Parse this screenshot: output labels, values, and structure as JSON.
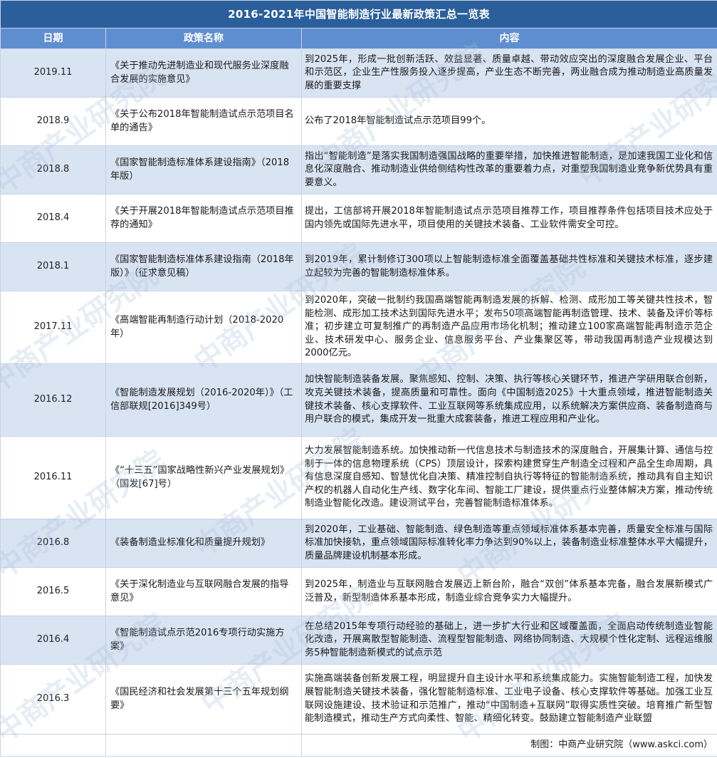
{
  "title": "2016-2021年中国智能制造行业最新政策汇总一览表",
  "headers": {
    "date": "日期",
    "name": "政策名称",
    "content": "内容"
  },
  "rows": [
    {
      "date": "2019.11",
      "name": "《关于推动先进制造业和现代服务业深度融合发展的实施意见》",
      "content": "到2025年，形成一批创新活跃、效益显著、质量卓越、带动效应突出的深度融合发展企业、平台和示范区，企业生产性服务投入逐步提高，产业生态不断完善，两业融合成为推动制造业高质量发展的重要支撑"
    },
    {
      "date": "2018.9",
      "name": "《关于公布2018年智能制造试点示范项目名单的通告》",
      "content": "公布了2018年智能制造试点示范项目99个。"
    },
    {
      "date": "2018.8",
      "name": "《国家智能制造标准体系建设指南》（2018年版）",
      "content": "指出“智能制造”是落实我国制造强国战略的重要举措，加快推进智能制造，是加速我国工业化和信息化深度融合、推动制造业供给侧结构性改革的重要着力点，对重塑我国制造业竞争新优势具有重要意义。"
    },
    {
      "date": "2018.4",
      "name": "《关于开展2018年智能制造试点示范项目推荐的通知》",
      "content": "提出，工信部将开展2018年智能制造试点示范项目推荐工作，项目推荐条件包括项目技术应处于国内领先或国际先进水平，项目使用的关键技术装备、工业软件需安全可控。"
    },
    {
      "date": "2018.1",
      "name": "《国家智能制造标准体系建设指南（2018年版）》（征求意见稿）",
      "content": "到2019年，累计制修订300项以上智能制造标准全面覆盖基础共性标准和关键技术标准，逐步建立起较为完善的智能制造标准体系。"
    },
    {
      "date": "2017.11",
      "name": "《高端智能再制造行动计划（2018-2020年）",
      "content": "到2020年，突破一批制约我国高端智能再制造发展的拆解、检测、成形加工等关键共性技术，智能检测、成形加工技术达到国际先进水平；发布50项高端智能再制造管理、技术、装备及评价等标准；初步建立可复制推广的再制造产品应用市场化机制；推动建立100家高端智能再制造示范企业、技术研发中心、服务企业、信息服务平台、产业集聚区等，带动我国再制造产业规模达到2000亿元。"
    },
    {
      "date": "2016.12",
      "name": "《智能制造发展规划（2016-2020年）》（工信部联规[2016]349号）",
      "content": "加快智能制造装备发展。聚焦感知、控制、决策、执行等核心关键环节，推进产学研用联合创新，攻克关键技术装备，提高质量和可靠性。面向《中国制造2025》十大重点领域，推进智能制造关键技术装备、核心支撑软件、工业互联网等系统集成应用，以系统解决方案供应商、装备制造商与用户联合的模式，集成开发一批重大成套装备，推进工程应用和产业化。"
    },
    {
      "date": "2016.11",
      "name": "《“十三五”国家战略性新兴产业发展规划》（国发[67]号）",
      "content": "大力发展智能制造系统。加快推动新一代信息技术与制造技术的深度融合，开展集计算、通信与控制于一体的信息物理系统（CPS）顶层设计，探索构建贯穿生产制造全过程和产品全生命周期，具有信息深度自感知、智慧优化自决策、精准控制自执行等特征的智能制造系统，推动具有自主知识产权的机器人自动化生产线、数字化车间、智能工厂建设，提供重点行业整体解决方案，推动传统制造业智能化改造。建设测试平台，完善智能制造标准体系。"
    },
    {
      "date": "2016.8",
      "name": "《装备制造业标准化和质量提升规划》",
      "content": "到2020年，工业基础、智能制造、绿色制造等重点领域标准体系基本完善，质量安全标准与国际标准加快接轨，重点领域国际标准转化率力争达到90%以上，装备制造业标准整体水平大幅提升，质量品牌建设机制基本形成。"
    },
    {
      "date": "2016.5",
      "name": "《关于深化制造业与互联网融合发展的指导意见》",
      "content": "到2025年，制造业与互联网融合发展迈上新台阶，融合“双创”体系基本完备，融合发展新模式广泛普及，新型制造体系基本形成，制造业综合竞争实力大幅提升。"
    },
    {
      "date": "2016.4",
      "name": "《智能制造试点示范2016专项行动实施方案》",
      "content": "在总结2015年专项行动经验的基础上，进一步扩大行业和区域覆盖面，全面启动传统制造业智能化改造，开展离散型智能制造、流程型智能制造、网络协同制造、大规模个性化定制、远程运维服务5种智能制造新模式的试点示范"
    },
    {
      "date": "2016.3",
      "name": "《国民经济和社会发展第十三个五年规划纲要》",
      "content": "实施高端装备创新发展工程，明显提升自主设计水平和系统集成能力。实施智能制造工程，加快发展智能制造关键技术装备，强化智能制造标准、工业电子设备、核心支撑软件等基础。加强工业互联网设施建设、技术验证和示范推广，推动“中国制造+互联网”取得实质性突破。培育推广新型智能制造模式，推动生产方式向柔性、智能、精细化转变。鼓励建立智能制造产业联盟"
    }
  ],
  "source": "制图：中商产业研究院（www.askci.com）",
  "watermark": "中商产业研究院"
}
